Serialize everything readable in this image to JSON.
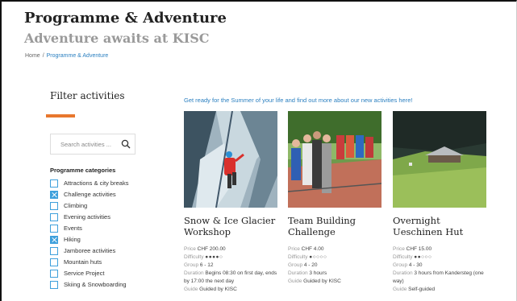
{
  "header": {
    "title": "Programme & Adventure",
    "subtitle": "Adventure awaits at KISC"
  },
  "breadcrumb": {
    "home": "Home",
    "separator": "/",
    "current": "Programme & Adventure"
  },
  "sidebar": {
    "filter_title": "Filter activities",
    "search_placeholder": "Search activities ...",
    "categories_heading": "Programme categories",
    "categories": [
      {
        "label": "Attractions & city breaks",
        "checked": false
      },
      {
        "label": "Challenge activities",
        "checked": true
      },
      {
        "label": "Climbing",
        "checked": false
      },
      {
        "label": "Evening activities",
        "checked": false
      },
      {
        "label": "Events",
        "checked": false
      },
      {
        "label": "Hiking",
        "checked": true
      },
      {
        "label": "Jamboree activities",
        "checked": false
      },
      {
        "label": "Mountain huts",
        "checked": false
      },
      {
        "label": "Service Project",
        "checked": false
      },
      {
        "label": "Skiing & Snowboarding",
        "checked": false
      }
    ]
  },
  "main": {
    "intro": "Get ready for the Summer of your life and find out more about our new activities here!",
    "labels": {
      "price": "Price",
      "difficulty": "Difficulty",
      "group": "Group",
      "duration": "Duration",
      "guide": "Guide"
    },
    "activities": [
      {
        "name": "Snow & Ice Glacier Workshop",
        "price": "CHF 200.00",
        "difficulty": "●●●●○",
        "group": "6 - 12",
        "duration": "Begins 08:30 on first day, ends by 17:00 the next day",
        "guide": "Guided by KISC"
      },
      {
        "name": "Team Building Challenge",
        "price": "CHF 4.00",
        "difficulty": "●○○○○",
        "group": "4 - 20",
        "duration": "3 hours",
        "guide": "Guided by KISC"
      },
      {
        "name": "Overnight Ueschinen Hut",
        "price": "CHF 15.00",
        "difficulty": "●●○○○",
        "group": "4 - 30",
        "duration": "3 hours from Kandersteg (one way)",
        "guide": "Self-guided"
      }
    ]
  },
  "colors": {
    "accent": "#e8772e",
    "link": "#2a7fc0",
    "checkbox": "#3ea0dc"
  }
}
